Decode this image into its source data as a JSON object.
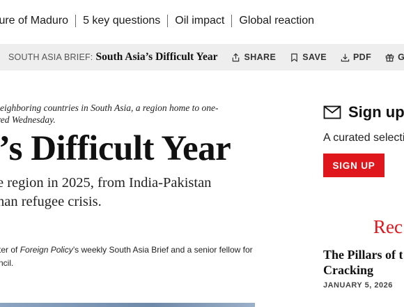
{
  "topnav": {
    "links": [
      "ture of Maduro",
      "5 key questions",
      "Oil impact",
      "Global reaction"
    ]
  },
  "brief_bar": {
    "kicker": "SOUTH ASIA BRIEF:",
    "title": "South Asia’s Difficult Year",
    "actions": [
      {
        "label": "SHARE",
        "icon": "share-icon"
      },
      {
        "label": "SAVE",
        "icon": "bookmark-icon"
      },
      {
        "label": "PDF",
        "icon": "download-icon"
      },
      {
        "label": "GIFT",
        "icon": "gift-icon"
      }
    ]
  },
  "article": {
    "dek_line1": "eighboring countries in South Asia, a region home to one-",
    "dek_line2": "red Wednesday.",
    "headline": "’s Difficult Year",
    "subhead_line1": "e region in 2025, from India-Pakistan",
    "subhead_line2": "han refugee crisis.",
    "byline_line1_pre": "ter of ",
    "byline_italic": "Foreign Policy",
    "byline_line1_post": "’s weekly South Asia Brief and a senior fellow for",
    "byline_line2": "ncil."
  },
  "rail": {
    "signup_title": "Sign up",
    "signup_desc": "A curated selectio",
    "signup_button": "SIGN UP",
    "rec_heading": "Rec",
    "rec_title_line1": "The Pillars of t",
    "rec_title_line2": "Cracking",
    "rec_date": "JANUARY 5, 2026",
    "accent_color": "#e0161d"
  }
}
